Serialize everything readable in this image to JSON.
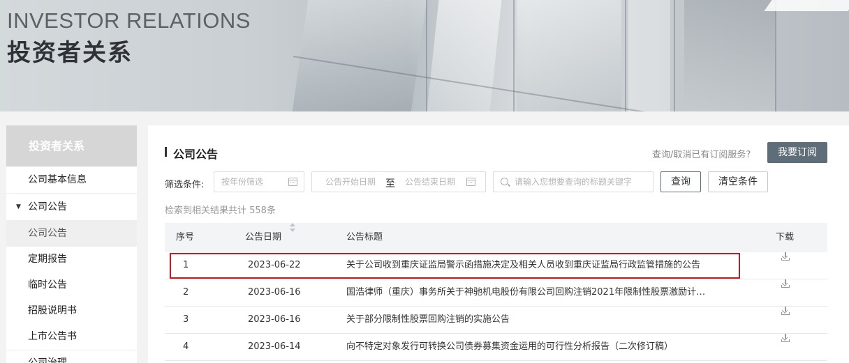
{
  "banner": {
    "title_en": "INVESTOR RELATIONS",
    "title_cn": "投资者关系"
  },
  "sidebar": {
    "header": "投资者关系",
    "items": [
      {
        "label": "公司基本信息"
      },
      {
        "label": "公司公告"
      },
      {
        "label": "公司公告"
      },
      {
        "label": "定期报告"
      },
      {
        "label": "临时公告"
      },
      {
        "label": "招股说明书"
      },
      {
        "label": "上市公告书"
      },
      {
        "label": "公司治理"
      }
    ]
  },
  "main": {
    "title": "公司公告",
    "subscription_question": "查询/取消已有订阅服务?",
    "subscribe_button": "我要订阅",
    "filter": {
      "label": "筛选条件:",
      "year_placeholder": "按年份筛选",
      "start_date_placeholder": "公告开始日期",
      "to_label": "至",
      "end_date_placeholder": "公告结束日期",
      "keyword_placeholder": "请输入您想要查询的标题关键字",
      "search_button": "查询",
      "clear_button": "清空条件"
    },
    "result_count": "检索到相关结果共计 558条",
    "table": {
      "headers": {
        "no": "序号",
        "date": "公告日期",
        "title": "公告标题",
        "download": "下载"
      },
      "rows": [
        {
          "no": "1",
          "date": "2023-06-22",
          "title": "关于公司收到重庆证监局警示函措施决定及相关人员收到重庆证监局行政监管措施的公告"
        },
        {
          "no": "2",
          "date": "2023-06-16",
          "title": "国浩律师（重庆）事务所关于神驰机电股份有限公司回购注销2021年限制性股票激励计…"
        },
        {
          "no": "3",
          "date": "2023-06-16",
          "title": "关于部分限制性股票回购注销的实施公告"
        },
        {
          "no": "4",
          "date": "2023-06-14",
          "title": "向不特定对象发行可转换公司债券募集资金运用的可行性分析报告（二次修订稿）"
        }
      ]
    }
  }
}
